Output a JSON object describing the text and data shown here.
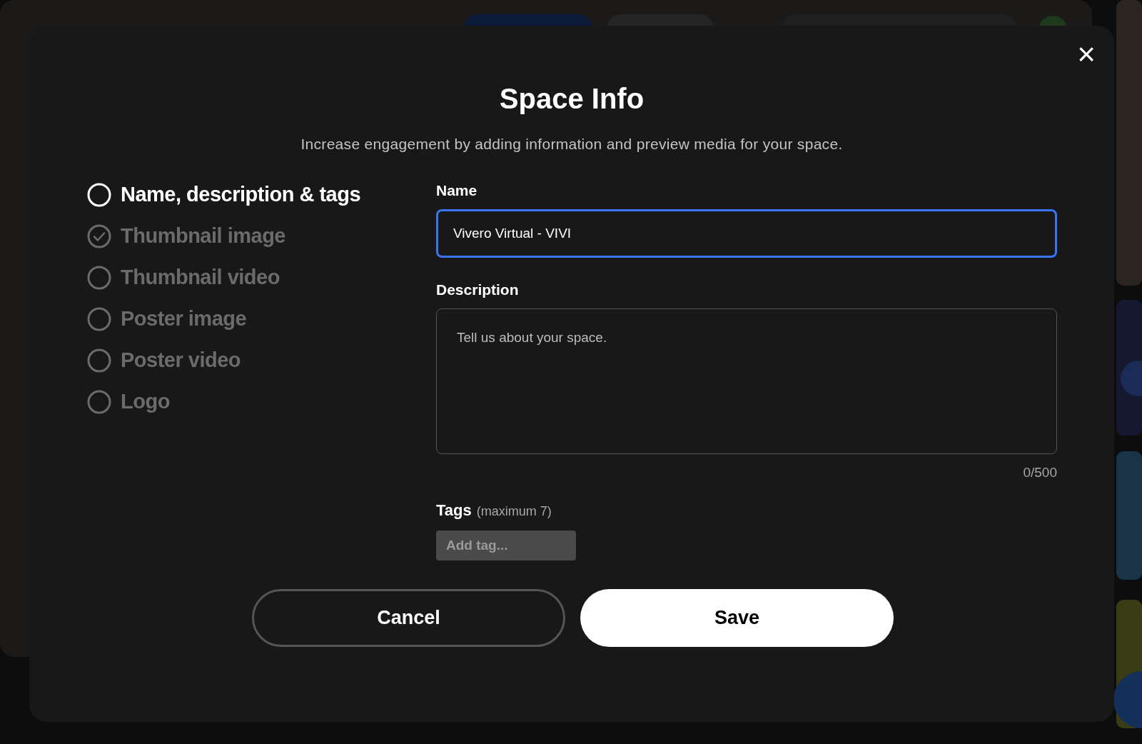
{
  "dialog": {
    "title": "Space Info",
    "subtitle": "Increase engagement by adding information and preview media for your space.",
    "close": "×"
  },
  "steps": [
    {
      "label": "Name, description & tags",
      "selected": true,
      "checked": false
    },
    {
      "label": "Thumbnail image",
      "selected": false,
      "checked": true
    },
    {
      "label": "Thumbnail video",
      "selected": false,
      "checked": false
    },
    {
      "label": "Poster image",
      "selected": false,
      "checked": false
    },
    {
      "label": "Poster video",
      "selected": false,
      "checked": false
    },
    {
      "label": "Logo",
      "selected": false,
      "checked": false
    }
  ],
  "name_field": {
    "label": "Name",
    "value": "Vivero Virtual - VIVI",
    "focused": true
  },
  "description_field": {
    "label": "Description",
    "placeholder": "Tell us about your space.",
    "counter": "0/500"
  },
  "tags": {
    "label": "Tags",
    "hint": "(maximum 7)",
    "placeholder": "Add tag..."
  },
  "buttons": [
    {
      "label": "Cancel",
      "kind": "secondary"
    },
    {
      "label": "Save",
      "kind": "primary"
    }
  ]
}
